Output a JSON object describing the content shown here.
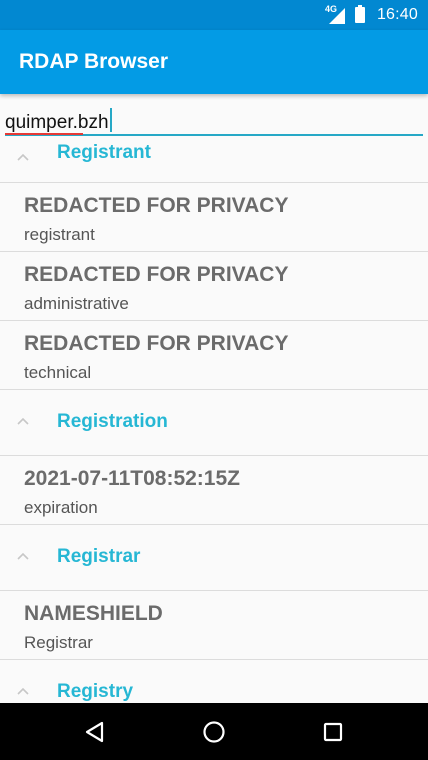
{
  "status_bar": {
    "network": "4G",
    "time": "16:40"
  },
  "app_bar": {
    "title": "RDAP Browser"
  },
  "search": {
    "value": "quimper.bzh"
  },
  "sections": [
    {
      "label": "Registrant"
    },
    {
      "label": "Registration"
    },
    {
      "label": "Registrar"
    },
    {
      "label": "Registry"
    }
  ],
  "registrant_items": [
    {
      "value": "REDACTED FOR PRIVACY",
      "role": "registrant"
    },
    {
      "value": "REDACTED FOR PRIVACY",
      "role": "administrative"
    },
    {
      "value": "REDACTED FOR PRIVACY",
      "role": "technical"
    }
  ],
  "registration_items": [
    {
      "value": "2021-07-11T08:52:15Z",
      "role": "expiration"
    }
  ],
  "registrar_items": [
    {
      "value": "NAMESHIELD",
      "role": "Registrar"
    }
  ],
  "nav": {
    "back_icon": "back-triangle-icon",
    "home_icon": "home-circle-icon",
    "recents_icon": "recents-square-icon"
  },
  "colors": {
    "status_bar": "#0288d1",
    "app_bar": "#039be5",
    "accent": "#26b7d4",
    "spellcheck": "#e53935"
  }
}
